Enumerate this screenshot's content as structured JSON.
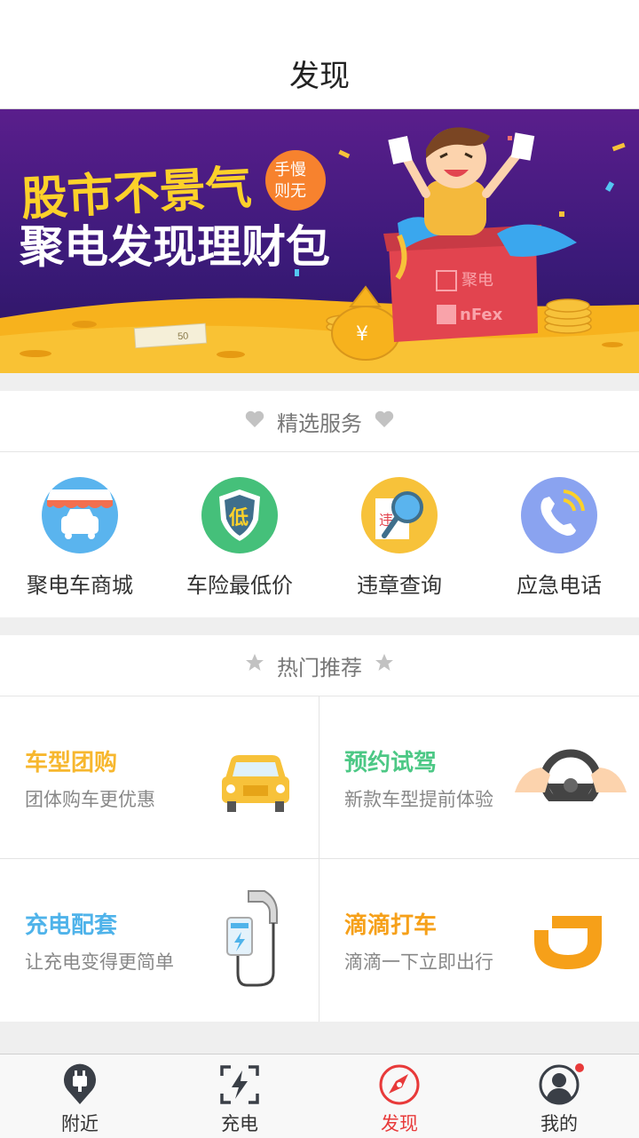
{
  "header": {
    "title": "发现"
  },
  "banner": {
    "line1": "股市不景气",
    "line2": "聚电发现理财包",
    "badge_line1": "手慢",
    "badge_line2": "则无",
    "box_brand1": "聚电",
    "box_brand2": "nFex",
    "bill_text": "50"
  },
  "featured": {
    "title": "精选服务",
    "items": [
      {
        "label": "聚电车商城",
        "icon": "car-shop-icon"
      },
      {
        "label": "车险最低价",
        "icon": "insurance-shield-icon",
        "icon_text": "低"
      },
      {
        "label": "违章查询",
        "icon": "violation-search-icon",
        "icon_text": "违"
      },
      {
        "label": "应急电话",
        "icon": "phone-icon"
      }
    ]
  },
  "hot": {
    "title": "热门推荐",
    "items": [
      {
        "title": "车型团购",
        "subtitle": "团体购车更优惠",
        "color": "#f7b72e",
        "icon": "yellow-car-icon"
      },
      {
        "title": "预约试驾",
        "subtitle": "新款车型提前体验",
        "color": "#4cc885",
        "icon": "steering-wheel-icon"
      },
      {
        "title": "充电配套",
        "subtitle": "让充电变得更简单",
        "color": "#4fb3ea",
        "icon": "charger-icon"
      },
      {
        "title": "滴滴打车",
        "subtitle": "滴滴一下立即出行",
        "color": "#f6a019",
        "icon": "didi-logo-icon"
      }
    ]
  },
  "tabbar": {
    "tabs": [
      {
        "label": "附近",
        "icon": "plug-pin-icon"
      },
      {
        "label": "充电",
        "icon": "lightning-frame-icon"
      },
      {
        "label": "发现",
        "icon": "compass-icon"
      },
      {
        "label": "我的",
        "icon": "profile-icon"
      }
    ],
    "active_color": "#e83a3a"
  }
}
